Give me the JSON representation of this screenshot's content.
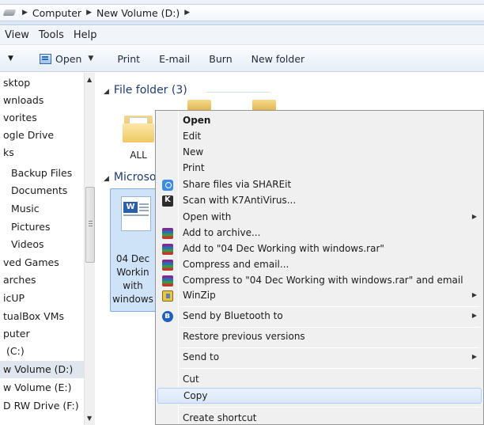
{
  "address_bar": {
    "crumbs": [
      "Computer",
      "New Volume (D:)"
    ]
  },
  "menu_bar": [
    "View",
    "Tools",
    "Help"
  ],
  "toolbar": {
    "open": "Open",
    "print": "Print",
    "email": "E-mail",
    "burn": "Burn",
    "new_folder": "New folder"
  },
  "nav_pane": {
    "items": [
      {
        "label": "sktop"
      },
      {
        "label": "wnloads"
      },
      {
        "label": "vorites"
      },
      {
        "label": "ogle Drive"
      },
      {
        "label": "ks"
      },
      {
        "label": "Backup Files"
      },
      {
        "label": "Documents"
      },
      {
        "label": "Music"
      },
      {
        "label": "Pictures"
      },
      {
        "label": "Videos"
      },
      {
        "label": "ved Games"
      },
      {
        "label": "arches"
      },
      {
        "label": "icUP"
      },
      {
        "label": "tualBox VMs"
      },
      {
        "label": "puter"
      },
      {
        "label": "(C:)"
      },
      {
        "label": "w Volume (D:)",
        "selected": true
      },
      {
        "label": "w Volume (E:)"
      },
      {
        "label": "D RW Drive (F:)"
      }
    ]
  },
  "content": {
    "group_folders": "File folder (3)",
    "folder_label": "ALL",
    "group_word": "Microso",
    "selected_file_lines": [
      "04 Dec",
      "Workin",
      "with",
      "windows"
    ]
  },
  "context_menu": {
    "items": [
      {
        "label": "Open",
        "bold": true
      },
      {
        "label": "Edit"
      },
      {
        "label": "New"
      },
      {
        "label": "Print"
      },
      {
        "label": "Share files via SHAREit",
        "icon": "shareit-icon"
      },
      {
        "label": "Scan with K7AntiVirus...",
        "icon": "k7-antivirus-icon"
      },
      {
        "label": "Open with",
        "submenu": true
      },
      {
        "label": "Add to archive...",
        "icon": "winrar-icon"
      },
      {
        "label": "Add to \"04 Dec Working with windows.rar\"",
        "icon": "winrar-icon"
      },
      {
        "label": "Compress and email...",
        "icon": "winrar-icon"
      },
      {
        "label": "Compress to \"04 Dec Working with windows.rar\" and email",
        "icon": "winrar-icon"
      },
      {
        "label": "WinZip",
        "icon": "winzip-icon",
        "submenu": true
      },
      {
        "label": "Send by Bluetooth to",
        "icon": "bluetooth-icon",
        "submenu": true
      },
      {
        "label": "Restore previous versions"
      },
      {
        "label": "Send to",
        "submenu": true
      },
      {
        "label": "Cut"
      },
      {
        "label": "Copy",
        "highlighted": true
      },
      {
        "label": "Create shortcut"
      }
    ]
  }
}
